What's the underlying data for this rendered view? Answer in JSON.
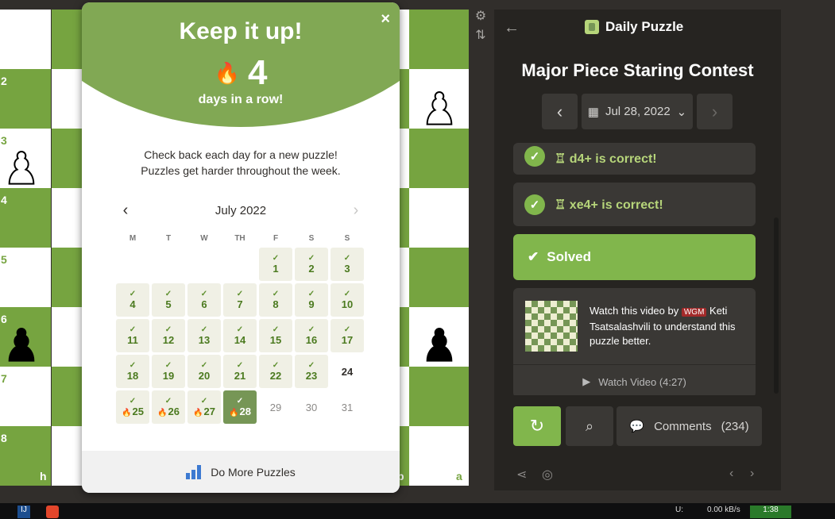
{
  "board": {
    "rank_labels": [
      "2",
      "3",
      "4",
      "5",
      "6",
      "7",
      "8"
    ],
    "file_labels": [
      "h",
      "b",
      "a"
    ]
  },
  "modal": {
    "title": "Keep it up!",
    "streak_count": "4",
    "streak_label": "days in a row!",
    "message_line1": "Check back each day for a new puzzle!",
    "message_line2": "Puzzles get harder throughout the week.",
    "close_label": "×",
    "footer_label": "Do More Puzzles",
    "calendar": {
      "month": "July 2022",
      "weekdays": [
        "M",
        "T",
        "W",
        "TH",
        "F",
        "S",
        "S"
      ],
      "leading_blanks": 4,
      "days": [
        {
          "day": "1",
          "state": "done"
        },
        {
          "day": "2",
          "state": "done"
        },
        {
          "day": "3",
          "state": "done"
        },
        {
          "day": "4",
          "state": "done"
        },
        {
          "day": "5",
          "state": "done"
        },
        {
          "day": "6",
          "state": "done"
        },
        {
          "day": "7",
          "state": "done"
        },
        {
          "day": "8",
          "state": "done"
        },
        {
          "day": "9",
          "state": "done"
        },
        {
          "day": "10",
          "state": "done"
        },
        {
          "day": "11",
          "state": "done"
        },
        {
          "day": "12",
          "state": "done"
        },
        {
          "day": "13",
          "state": "done"
        },
        {
          "day": "14",
          "state": "done"
        },
        {
          "day": "15",
          "state": "done"
        },
        {
          "day": "16",
          "state": "done"
        },
        {
          "day": "17",
          "state": "done"
        },
        {
          "day": "18",
          "state": "done"
        },
        {
          "day": "19",
          "state": "done"
        },
        {
          "day": "20",
          "state": "done"
        },
        {
          "day": "21",
          "state": "done"
        },
        {
          "day": "22",
          "state": "done"
        },
        {
          "day": "23",
          "state": "done"
        },
        {
          "day": "24",
          "state": "next"
        },
        {
          "day": "25",
          "state": "streak"
        },
        {
          "day": "26",
          "state": "streak"
        },
        {
          "day": "27",
          "state": "streak"
        },
        {
          "day": "28",
          "state": "today"
        },
        {
          "day": "29",
          "state": "future"
        },
        {
          "day": "30",
          "state": "future"
        },
        {
          "day": "31",
          "state": "future"
        }
      ]
    }
  },
  "panel": {
    "header_title": "Daily Puzzle",
    "puzzle_name": "Major Piece Staring Contest",
    "date": "Jul 28, 2022",
    "moves": [
      {
        "text": "♖ d4+ is correct!"
      },
      {
        "text": "♖ xe4+ is correct!"
      }
    ],
    "solved_label": "Solved",
    "video": {
      "text_before": "Watch this video by",
      "title_badge": "WGM",
      "text_after": "Keti Tsatsalashvili to understand this puzzle better.",
      "button_label": "Watch Video (4:27)"
    },
    "comments_label": "Comments",
    "comments_count": "(234)"
  },
  "taskbar": {
    "net_label": "U:",
    "net_speed": "0.00 kB/s",
    "clock": "1:38"
  },
  "colors": {
    "board_dark": "#76a440",
    "board_light": "#ffffff",
    "accent_green": "#81b64c",
    "panel_bg": "#262421"
  }
}
